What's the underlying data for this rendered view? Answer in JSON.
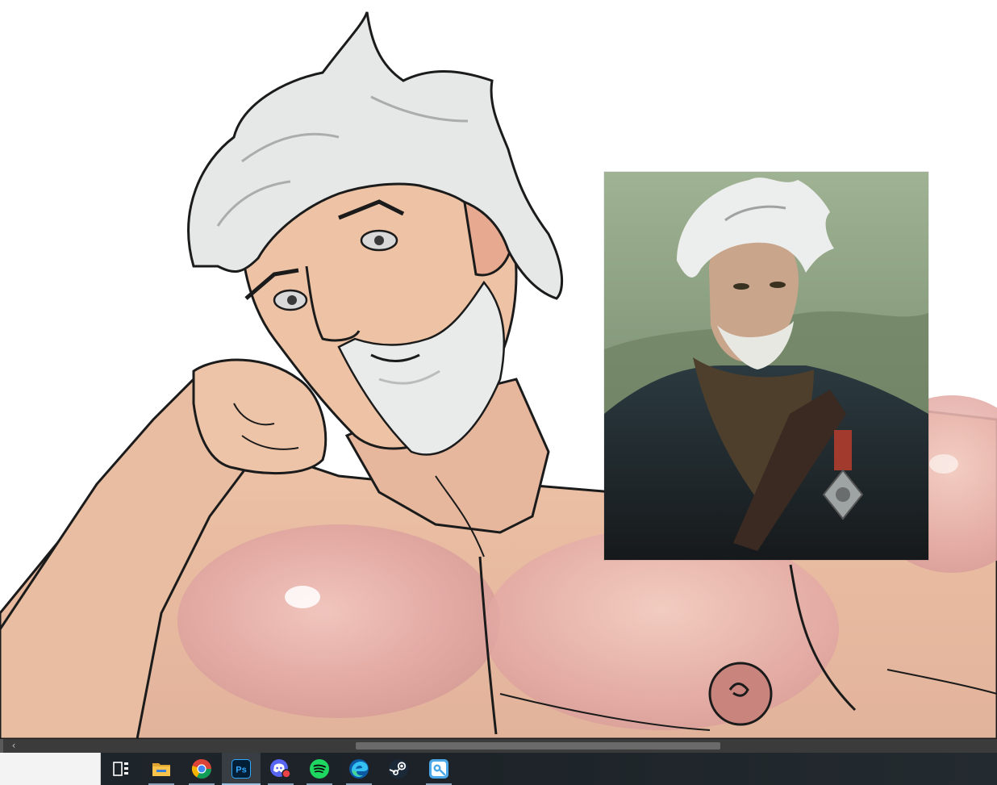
{
  "reference": {
    "description_icon": "reference-portrait-image"
  },
  "canvas": {
    "icon": "line-art-canvas"
  },
  "scrollbar": {
    "left_arrow": "‹",
    "thumb_fraction_start": 0.357,
    "thumb_fraction_width": 0.366
  },
  "taskbar": {
    "search_value": "",
    "apps": [
      {
        "id": "task-view",
        "icon": "task-view-icon",
        "running": false
      },
      {
        "id": "file-explorer",
        "icon": "folder-icon",
        "running": true
      },
      {
        "id": "chrome",
        "icon": "chrome-icon",
        "running": true
      },
      {
        "id": "photoshop",
        "icon": "photoshop-icon",
        "label": "Ps",
        "running": true,
        "active": true
      },
      {
        "id": "discord",
        "icon": "discord-icon",
        "running": true
      },
      {
        "id": "spotify",
        "icon": "spotify-icon",
        "running": true
      },
      {
        "id": "edge",
        "icon": "edge-icon",
        "running": true
      },
      {
        "id": "steam",
        "icon": "steam-icon",
        "running": false
      },
      {
        "id": "pure-ref",
        "icon": "pureref-icon",
        "running": true
      }
    ],
    "colors": {
      "photoshop_bg": "#001e36",
      "photoshop_fg": "#31a8ff",
      "spotify": "#1ed760",
      "discord": "#5865f2",
      "folder": "#f8c24b",
      "accent_underline": "#8aa2b8"
    }
  }
}
